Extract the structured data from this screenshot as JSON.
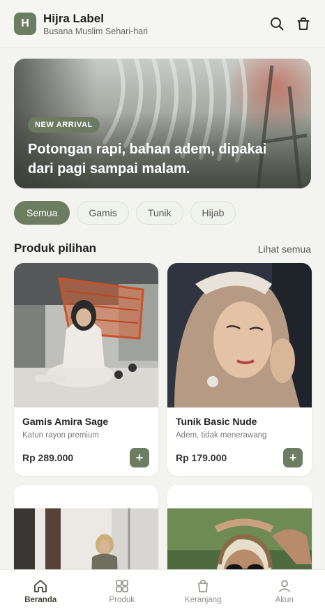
{
  "brand": {
    "logo_letter": "H",
    "name": "Hijra Label",
    "tagline": "Busana Muslim Sehari-hari"
  },
  "header_icons": [
    "search-icon",
    "shopping-bag-icon"
  ],
  "hero": {
    "badge": "NEW ARRIVAL",
    "headline": "Potongan rapi, bahan adem, dipakai dari pagi sampai malam."
  },
  "chips": [
    {
      "label": "Semua",
      "active": true
    },
    {
      "label": "Gamis",
      "active": false
    },
    {
      "label": "Tunik",
      "active": false
    },
    {
      "label": "Hijab",
      "active": false
    }
  ],
  "section": {
    "title": "Produk pilihan",
    "see_all": "Lihat semua"
  },
  "products": [
    {
      "name": "Gamis Amira Sage",
      "desc": "Katun rayon premium",
      "price": "Rp 289.000",
      "add": "+"
    },
    {
      "name": "Tunik Basic Nude",
      "desc": "Adem, tidak menerawang",
      "price": "Rp 179.000",
      "add": "+"
    }
  ],
  "nav": [
    {
      "label": "Beranda",
      "icon": "home-icon",
      "active": true
    },
    {
      "label": "Produk",
      "icon": "grid-icon",
      "active": false
    },
    {
      "label": "Keranjang",
      "icon": "shopping-bag-icon",
      "active": false
    },
    {
      "label": "Akun",
      "icon": "user-icon",
      "active": false
    }
  ],
  "colors": {
    "accent": "#6d7d61",
    "background": "#f3f4f0"
  }
}
